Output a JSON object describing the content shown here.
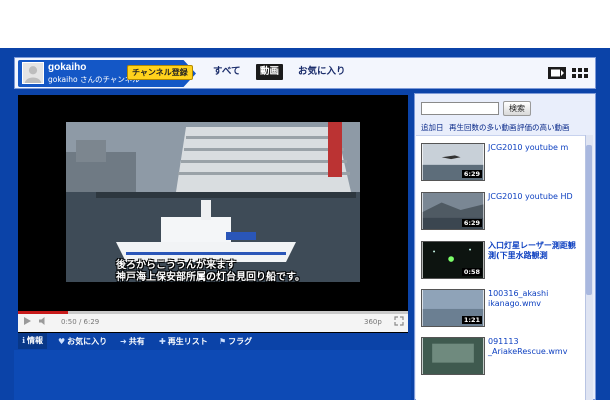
{
  "channel": {
    "name": "gokaiho",
    "subtitle": "gokaiho さんのチャンネル",
    "subscribe_label": "チャンネル登録"
  },
  "tabs": [
    {
      "label": "すべて",
      "active": false
    },
    {
      "label": "動画",
      "active": true
    },
    {
      "label": "お気に入り",
      "active": false
    }
  ],
  "view_icons": [
    "player-view-icon",
    "grid-view-icon"
  ],
  "player": {
    "subtitle_line1": "後ろからこううんが来ます",
    "subtitle_line2": "神戸海上保安部所属の灯台見回り船です。",
    "time": "0:50 / 6:29",
    "progress": 0.128,
    "quality": "360p"
  },
  "actions": [
    {
      "icon": "info-icon",
      "label": "情報"
    },
    {
      "icon": "heart-icon",
      "label": "お気に入り"
    },
    {
      "icon": "share-icon",
      "label": "共有"
    },
    {
      "icon": "playlist-add-icon",
      "label": "再生リスト"
    },
    {
      "icon": "flag-icon",
      "label": "フラグ"
    }
  ],
  "sidebar": {
    "search_placeholder": "",
    "search_button": "検索",
    "sort_options": [
      "追加日",
      "再生回数の多い動画",
      "評価の高い動画"
    ],
    "videos": [
      {
        "title": "JCG2010 youtube m",
        "duration": "6:29"
      },
      {
        "title": "JCG2010 youtube HD",
        "duration": "6:29"
      },
      {
        "title": "入口灯星レーザー測距観測(下里水路観測",
        "duration": "0:58"
      },
      {
        "title": "100316_akashi ikanago.wmv",
        "duration": "1:21"
      },
      {
        "title": "091113 _AriakeRescue.wmv",
        "duration": ""
      }
    ]
  },
  "colors": {
    "frame_blue": "#0b43a8",
    "link_blue": "#0c3fc0",
    "subscribe_yellow": "#ffd21c",
    "progress_red": "#c71a1a"
  }
}
